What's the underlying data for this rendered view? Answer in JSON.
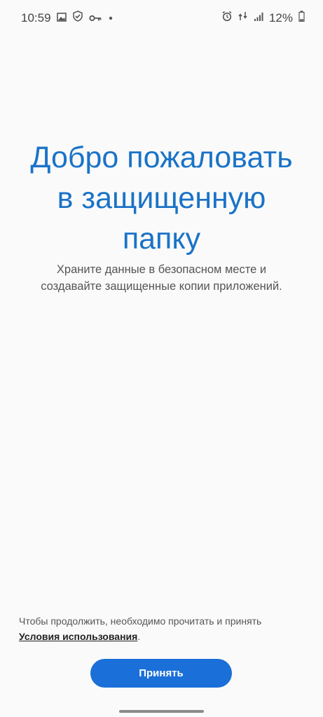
{
  "status_bar": {
    "time": "10:59",
    "battery": "12%",
    "left_icons": [
      "gallery-icon",
      "shield-check-icon",
      "key-icon",
      "dot-icon"
    ],
    "right_icons": [
      "alarm-icon",
      "data-arrows-icon",
      "signal-icon",
      "battery-icon"
    ]
  },
  "welcome": {
    "title_line1": "Добро пожаловать",
    "title_line2": "в защищенную",
    "title_line3": "папку",
    "subtitle_line1": "Храните данные в безопасном месте и",
    "subtitle_line2": "создавайте защищенные копии приложений."
  },
  "footer": {
    "terms_text": "Чтобы продолжить, необходимо прочитать и принять",
    "terms_link": "Условия использования",
    "terms_suffix": ".",
    "accept_label": "Принять"
  },
  "colors": {
    "accent": "#1a73c7",
    "button": "#1a6fd8",
    "background": "#fafafa"
  }
}
